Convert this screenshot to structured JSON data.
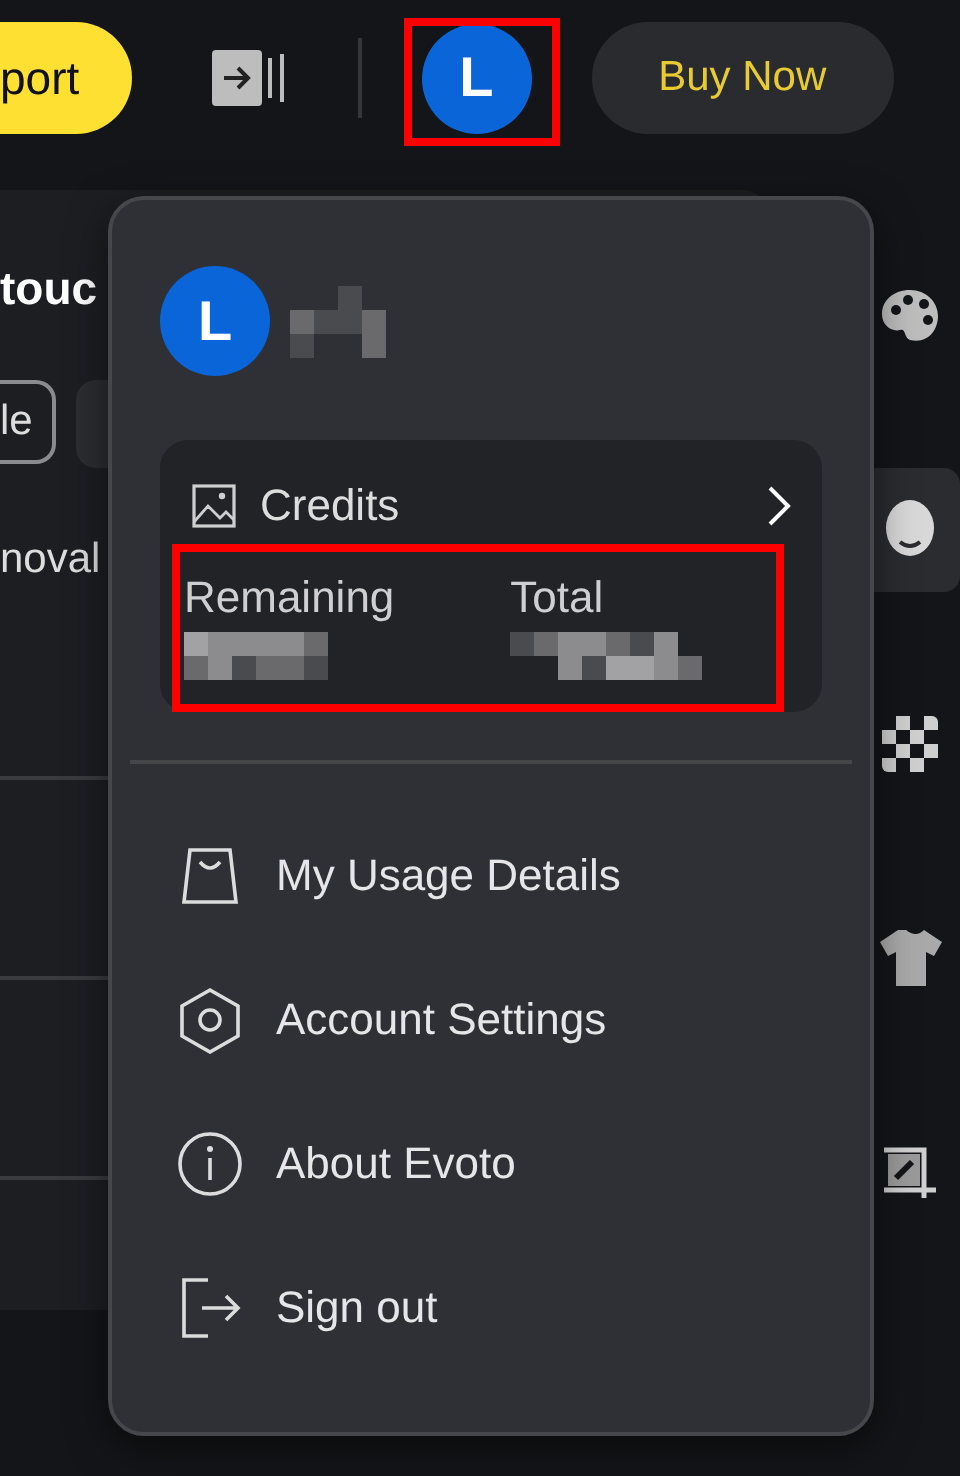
{
  "toolbar": {
    "export_button": "port",
    "avatar": "L",
    "buy_button": "Buy Now"
  },
  "background_panel": {
    "heading": "touc",
    "chip": "le",
    "label": "noval"
  },
  "sidebar": {
    "tools": [
      {
        "kind": "palette",
        "selected": false
      },
      {
        "kind": "face",
        "selected": true
      },
      {
        "kind": "checker",
        "selected": false
      },
      {
        "kind": "shirt",
        "selected": false
      },
      {
        "kind": "crop",
        "selected": false
      }
    ]
  },
  "account_menu": {
    "avatar": "L",
    "credits": {
      "title": "Credits",
      "columns": [
        "Remaining",
        "Total"
      ]
    },
    "items": [
      {
        "kind": "usage",
        "label": "My Usage Details"
      },
      {
        "kind": "settings",
        "label": "Account Settings"
      },
      {
        "kind": "about",
        "label": "About Evoto"
      },
      {
        "kind": "signout",
        "label": "Sign out"
      }
    ]
  }
}
